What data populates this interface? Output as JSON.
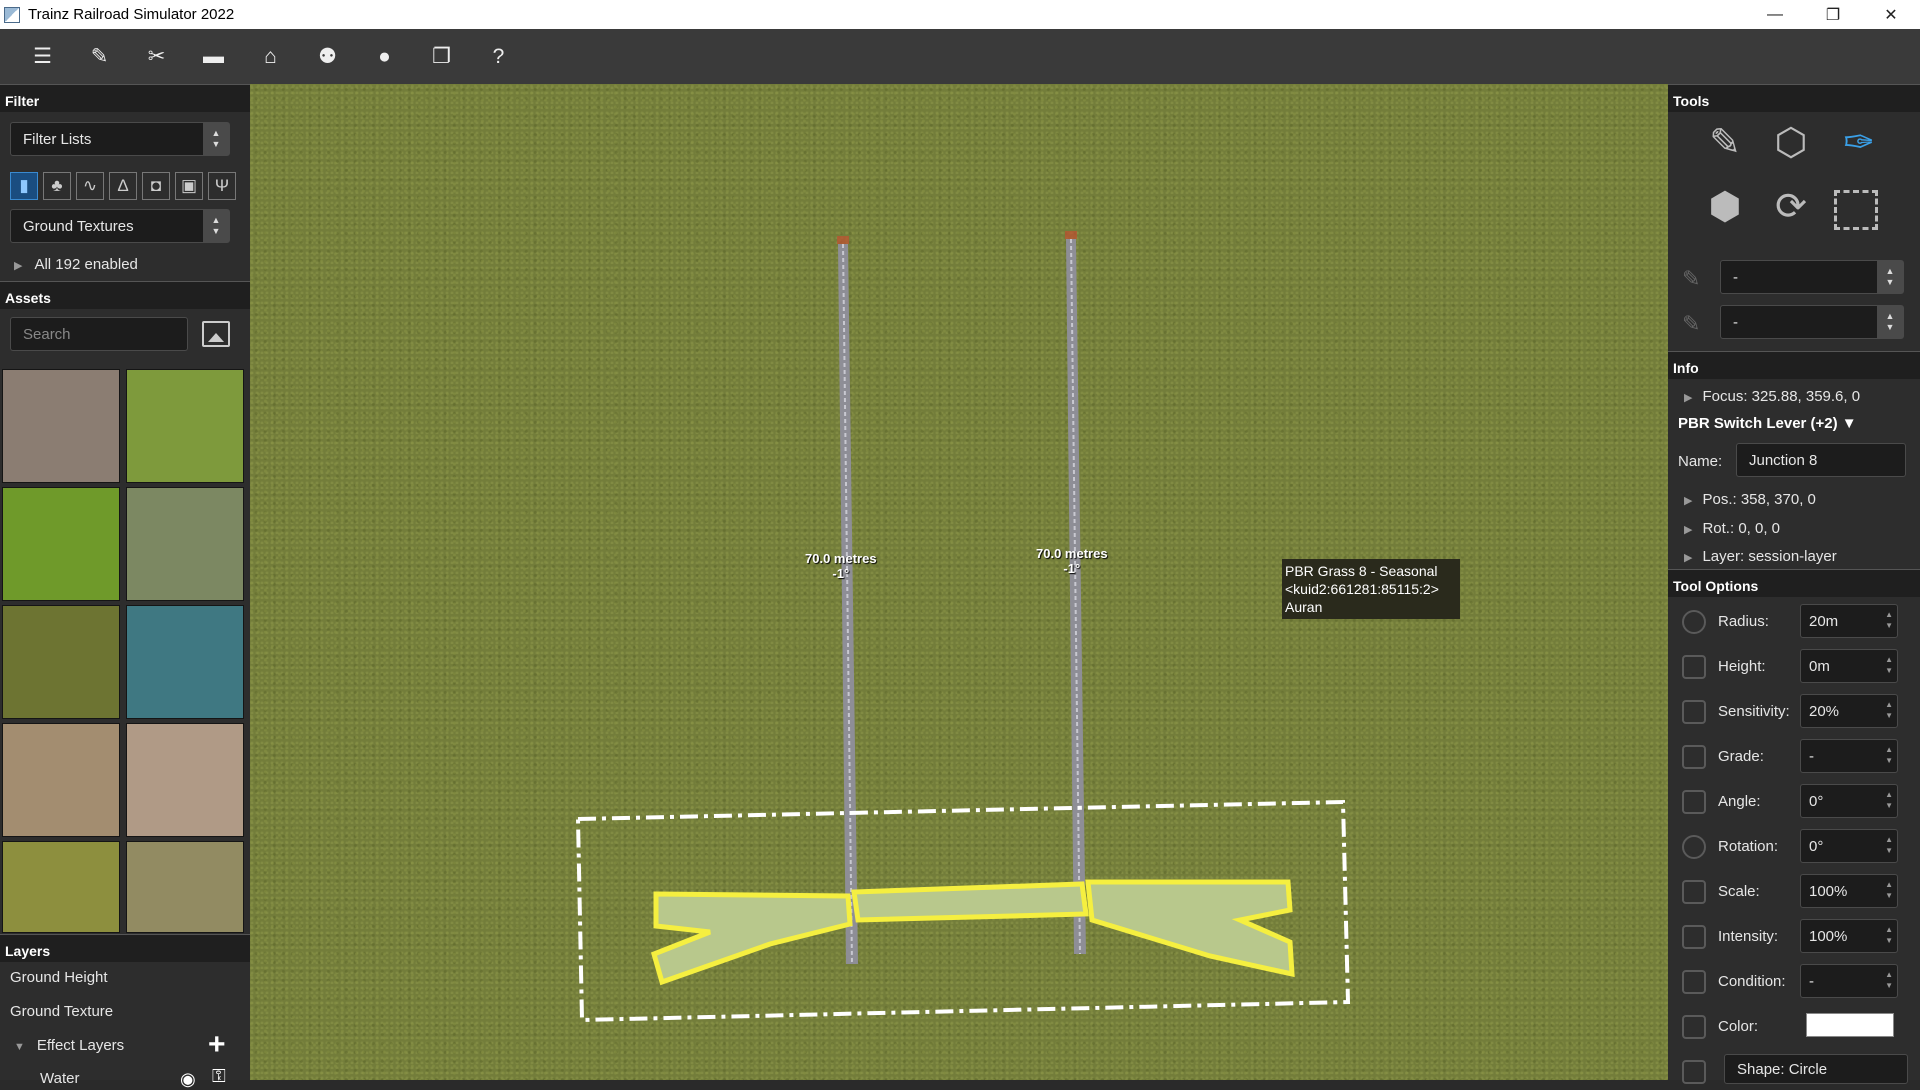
{
  "window": {
    "title": "Trainz Railroad Simulator 2022",
    "controls": [
      "—",
      "❐",
      "✕"
    ]
  },
  "toolbar": {
    "buttons": [
      {
        "name": "menu-icon",
        "glyph": "☰"
      },
      {
        "name": "edit-icon",
        "glyph": "✎"
      },
      {
        "name": "tools-icon",
        "glyph": "✂"
      },
      {
        "name": "display-icon",
        "glyph": "▬"
      },
      {
        "name": "camera-icon",
        "glyph": "⌂"
      },
      {
        "name": "crowd-icon",
        "glyph": "⚉"
      },
      {
        "name": "chat-icon",
        "glyph": "●"
      },
      {
        "name": "window-icon",
        "glyph": "❐"
      },
      {
        "name": "help-icon",
        "glyph": "?"
      }
    ]
  },
  "filter": {
    "header": "Filter",
    "list_dropdown": "Filter Lists",
    "category_dropdown": "Ground Textures",
    "enabled_text": "All 192 enabled"
  },
  "assets": {
    "header": "Assets",
    "search_placeholder": "Search",
    "tiles": [
      "#8b7d72",
      "#7e9a3c",
      "#6f9a2a",
      "#7c8862",
      "#6d7432",
      "#3f7882",
      "#a38d70",
      "#b09a86",
      "#8d8f3e",
      "#928b62"
    ]
  },
  "layers": {
    "header": "Layers",
    "items": [
      "Ground Height",
      "Ground Texture"
    ],
    "effect_group": "Effect Layers",
    "effect_items": [
      "Water"
    ]
  },
  "viewport": {
    "track_label_1": "70.0 metres",
    "track_sub_1": "-1°",
    "track_label_2": "70.0 metres",
    "track_sub_2": "-1°",
    "tooltip_line1": "PBR Grass 8 - Seasonal",
    "tooltip_line2": "<kuid2:661281:85115:2>",
    "tooltip_line3": "Auran"
  },
  "tools": {
    "header": "Tools",
    "paint_dropdown_1": "-",
    "paint_dropdown_2": "-"
  },
  "info": {
    "header": "Info",
    "focus": "Focus: 325.88, 359.6, 0",
    "object_title": "PBR Switch Lever (+2) ▼",
    "name_label": "Name:",
    "name_value": "Junction 8",
    "pos": "Pos.: 358, 370, 0",
    "rot": "Rot.: 0, 0, 0",
    "layer": "Layer: session-layer"
  },
  "tool_options": {
    "header": "Tool Options",
    "options": [
      {
        "label": "Radius:",
        "value": "20m"
      },
      {
        "label": "Height:",
        "value": "0m"
      },
      {
        "label": "Sensitivity:",
        "value": "20%"
      },
      {
        "label": "Grade:",
        "value": "-"
      },
      {
        "label": "Angle:",
        "value": "0°"
      },
      {
        "label": "Rotation:",
        "value": "0°"
      },
      {
        "label": "Scale:",
        "value": "100%"
      },
      {
        "label": "Intensity:",
        "value": "100%"
      },
      {
        "label": "Condition:",
        "value": "-"
      }
    ],
    "color_label": "Color:",
    "color_value": "#ffffff",
    "shape": "Shape: Circle"
  }
}
